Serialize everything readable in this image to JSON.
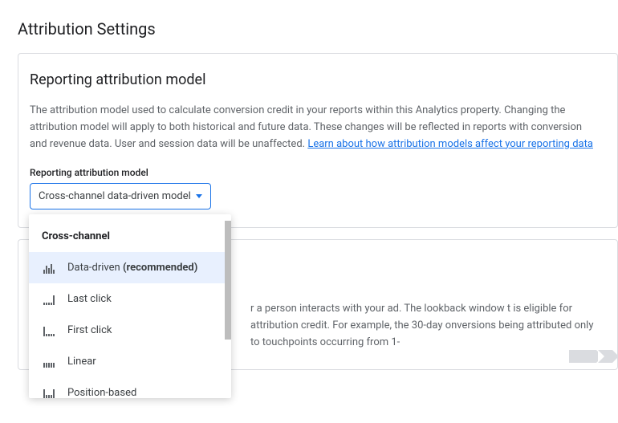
{
  "page": {
    "title": "Attribution Settings"
  },
  "card1": {
    "title": "Reporting attribution model",
    "description_part1": "The attribution model used to calculate conversion credit in your reports within this Analytics property. Changing the attribution model will apply to both historical and future data. These changes will be reflected in reports with conversion and revenue data. User and session data will be unaffected. ",
    "learn_link": "Learn about how attribution models affect your reporting data",
    "field_label": "Reporting attribution model",
    "selected_value": "Cross-channel data-driven model"
  },
  "dropdown": {
    "group_header": "Cross-channel",
    "options": [
      {
        "label": "Data-driven",
        "suffix": " (recommended)",
        "selected": true,
        "icon": "bars-data-driven"
      },
      {
        "label": "Last click",
        "suffix": "",
        "selected": false,
        "icon": "bars-last-click"
      },
      {
        "label": "First click",
        "suffix": "",
        "selected": false,
        "icon": "bars-first-click"
      },
      {
        "label": "Linear",
        "suffix": "",
        "selected": false,
        "icon": "bars-linear"
      },
      {
        "label": "Position-based",
        "suffix": "",
        "selected": false,
        "icon": "bars-position-based"
      }
    ]
  },
  "card2": {
    "description": "r a person interacts with your ad. The lookback window t is eligible for attribution credit. For example, the 30-day onversions being attributed only to touchpoints occurring from 1-"
  },
  "colors": {
    "link": "#1a73e8",
    "border": "#dadce0",
    "text_secondary": "#5f6368",
    "selected_bg": "#e8f0fe"
  }
}
